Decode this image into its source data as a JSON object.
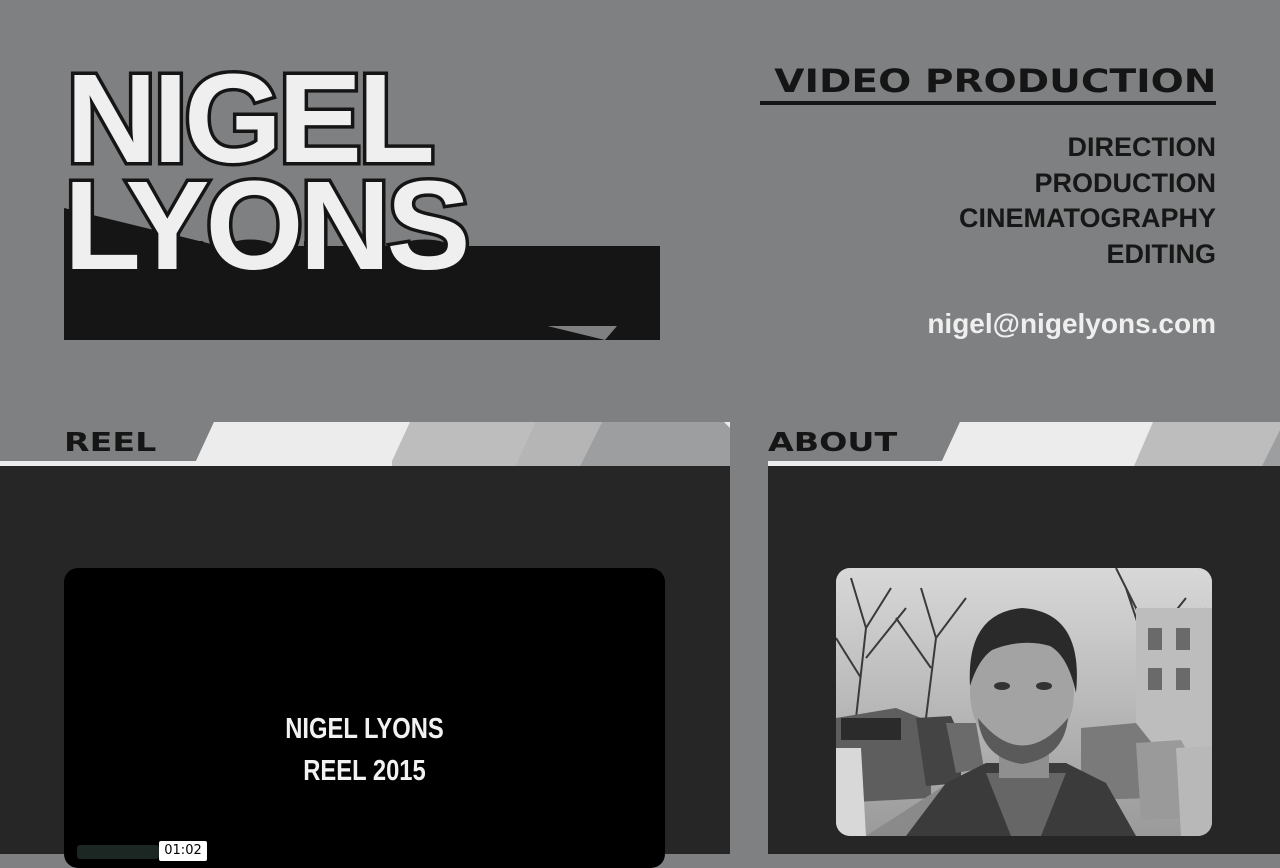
{
  "header": {
    "logo_line1": "NIGEL",
    "logo_line2": "LYONS",
    "services_title": "VIDEO PRODUCTION",
    "services": [
      "DIRECTION",
      "PRODUCTION",
      "CINEMATOGRAPHY",
      "EDITING"
    ],
    "email": "nigel@nigelyons.com"
  },
  "reel": {
    "section_label": "REEL",
    "video_title_line1": "NIGEL LYONS",
    "video_title_line2": "REEL 2015",
    "time": "01:02"
  },
  "about": {
    "section_label": "ABOUT",
    "portrait_icon": "portrait-photo"
  },
  "colors": {
    "page_background": "#7f8082",
    "panel_background": "#262626",
    "logo_fill": "#efefef",
    "logo_shadow": "#151515",
    "tab_stripe_light": "#ececec",
    "tab_stripe_mid": "#bdbdbd",
    "tab_stripe_dark": "#9d9ea0"
  }
}
